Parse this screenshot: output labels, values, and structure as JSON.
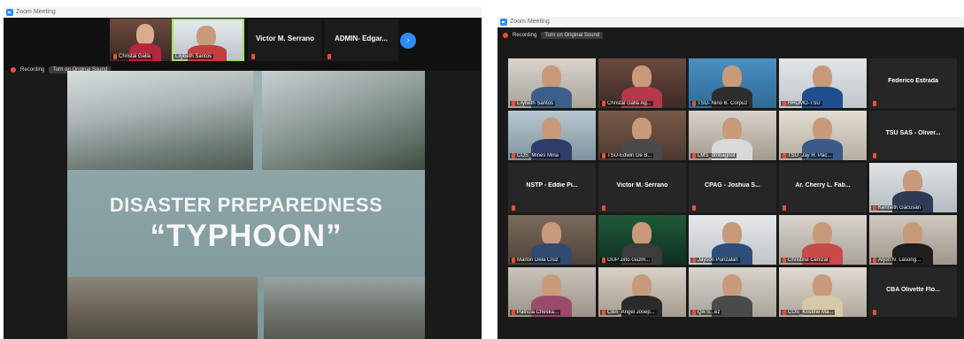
{
  "app_title": "Zoom Meeting",
  "recording_label": "Recording",
  "original_sound_label": "Turn on Original Sound",
  "left": {
    "strip": [
      {
        "name": "Christal Galla",
        "has_video": true
      },
      {
        "name": "Lilybeth Santos",
        "has_video": true
      },
      {
        "name": "Victor M. Serrano",
        "has_video": false
      },
      {
        "name": "ADMIN- Edgar...",
        "has_video": false
      }
    ],
    "next_arrow": "›",
    "slide": {
      "title": "DISASTER PREPAREDNESS",
      "subtitle": "“TYPHOON”"
    }
  },
  "right": {
    "gallery": [
      {
        "name": "Lilybeth Santos",
        "video": true
      },
      {
        "name": "Christal Galla Ag...",
        "video": true
      },
      {
        "name": "TSU- Niño B. Corpuz",
        "video": true
      },
      {
        "name": "HRDMO-TSU",
        "video": true,
        "active": true
      },
      {
        "name": "Federico Estrada",
        "video": false
      },
      {
        "name": "COS_Mines Mina",
        "video": true
      },
      {
        "name": "TSU-Edwin De B...",
        "video": true
      },
      {
        "name": "LMS_dmbagnot",
        "video": true
      },
      {
        "name": "TSU_Jay R. Pac...",
        "video": true
      },
      {
        "name": "TSU SAS - Oliver...",
        "video": false
      },
      {
        "name": "NSTP - Eddie Pi...",
        "video": false
      },
      {
        "name": "Victor M. Serrano",
        "video": false
      },
      {
        "name": "CPAG - Joshua S...",
        "video": false
      },
      {
        "name": "Ar. Cherry L. Fab...",
        "video": false
      },
      {
        "name": "Kenneth Gacusan",
        "video": true
      },
      {
        "name": "Marlon Dela Cruz",
        "video": true
      },
      {
        "name": "OUP Jirlo Guzm...",
        "video": true
      },
      {
        "name": "Jayson Punzalan",
        "video": true
      },
      {
        "name": "Christine Cenizal",
        "video": true
      },
      {
        "name": "Arjon N. Lasong...",
        "video": true
      },
      {
        "name": "Patricia Cheska...",
        "video": true
      },
      {
        "name": "CBA_Angel Josep...",
        "video": true
      },
      {
        "name": "QA S...ez",
        "video": true
      },
      {
        "name": "COS_Kristine Ma...",
        "video": true
      },
      {
        "name": "CBA Olivette Flo...",
        "video": false
      }
    ]
  }
}
